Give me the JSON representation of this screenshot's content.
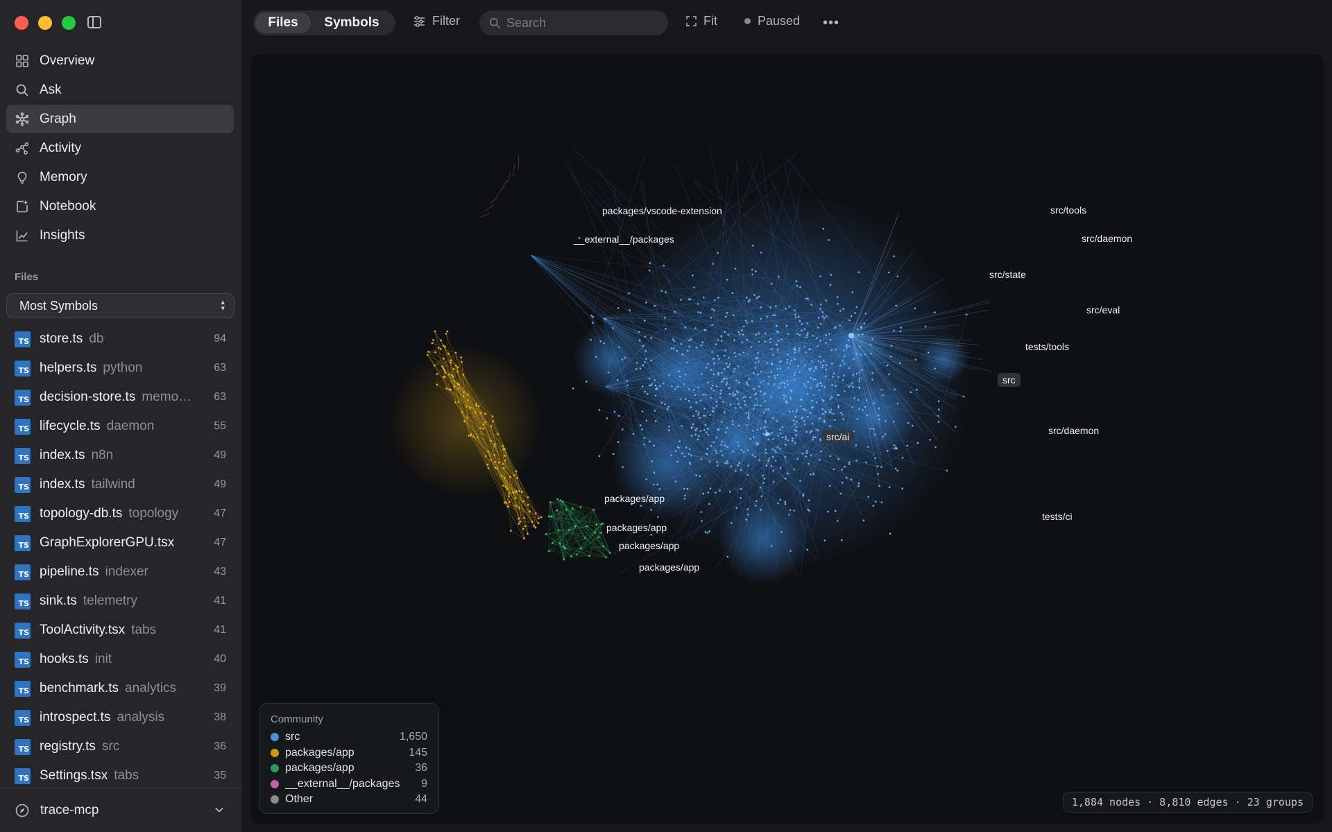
{
  "nav": [
    {
      "label": "Overview",
      "icon": "grid-icon"
    },
    {
      "label": "Ask",
      "icon": "search-icon"
    },
    {
      "label": "Graph",
      "icon": "graph-icon",
      "active": true
    },
    {
      "label": "Activity",
      "icon": "activity-icon"
    },
    {
      "label": "Memory",
      "icon": "lightbulb-icon"
    },
    {
      "label": "Notebook",
      "icon": "notebook-icon"
    },
    {
      "label": "Insights",
      "icon": "chart-line-icon"
    }
  ],
  "files_section": {
    "heading": "Files",
    "sort_value": "Most Symbols",
    "badge": "TS",
    "items": [
      {
        "name": "store.ts",
        "dir": "db",
        "count": "94"
      },
      {
        "name": "helpers.ts",
        "dir": "python",
        "count": "63"
      },
      {
        "name": "decision-store.ts",
        "dir": "memo…",
        "count": "63"
      },
      {
        "name": "lifecycle.ts",
        "dir": "daemon",
        "count": "55"
      },
      {
        "name": "index.ts",
        "dir": "n8n",
        "count": "49"
      },
      {
        "name": "index.ts",
        "dir": "tailwind",
        "count": "49"
      },
      {
        "name": "topology-db.ts",
        "dir": "topology",
        "count": "47"
      },
      {
        "name": "GraphExplorerGPU.tsx",
        "dir": "",
        "count": "47"
      },
      {
        "name": "pipeline.ts",
        "dir": "indexer",
        "count": "43"
      },
      {
        "name": "sink.ts",
        "dir": "telemetry",
        "count": "41"
      },
      {
        "name": "ToolActivity.tsx",
        "dir": "tabs",
        "count": "41"
      },
      {
        "name": "hooks.ts",
        "dir": "init",
        "count": "40"
      },
      {
        "name": "benchmark.ts",
        "dir": "analytics",
        "count": "39"
      },
      {
        "name": "introspect.ts",
        "dir": "analysis",
        "count": "38"
      },
      {
        "name": "registry.ts",
        "dir": "src",
        "count": "36"
      },
      {
        "name": "Settings.tsx",
        "dir": "tabs",
        "count": "35"
      }
    ]
  },
  "footer": {
    "project": "trace-mcp"
  },
  "toolbar": {
    "tabs": [
      "Files",
      "Symbols"
    ],
    "filter_label": "Filter",
    "search_placeholder": "Search",
    "fit_label": "Fit",
    "status_label": "Paused"
  },
  "graph": {
    "labels": [
      {
        "text": "packages/vscode-extension",
        "x": 0,
        "y": 0
      },
      {
        "text": "__external__/packages"
      },
      {
        "text": "src/tools"
      },
      {
        "text": "src/daemon"
      },
      {
        "text": "src/state"
      },
      {
        "text": "src/eval"
      },
      {
        "text": "tests/tools"
      },
      {
        "text": "src"
      },
      {
        "text": "src/ai"
      },
      {
        "text": "src/daemon"
      },
      {
        "text": "packages/app"
      },
      {
        "text": "tests/ci"
      },
      {
        "text": "packages/app"
      },
      {
        "text": "packages/app"
      },
      {
        "text": "packages/app"
      }
    ]
  },
  "legend": {
    "title": "Community",
    "items": [
      {
        "label": "src",
        "count": "1,650",
        "color": "#4a8fe0"
      },
      {
        "label": "packages/app",
        "count": "145",
        "color": "#c99a16"
      },
      {
        "label": "packages/app",
        "count": "36",
        "color": "#2e9a55"
      },
      {
        "label": "__external__/packages",
        "count": "9",
        "color": "#c060a8"
      },
      {
        "label": "Other",
        "count": "44",
        "color": "#8a8a8f"
      }
    ]
  },
  "stats": "1,884 nodes · 8,810 edges · 23 groups"
}
